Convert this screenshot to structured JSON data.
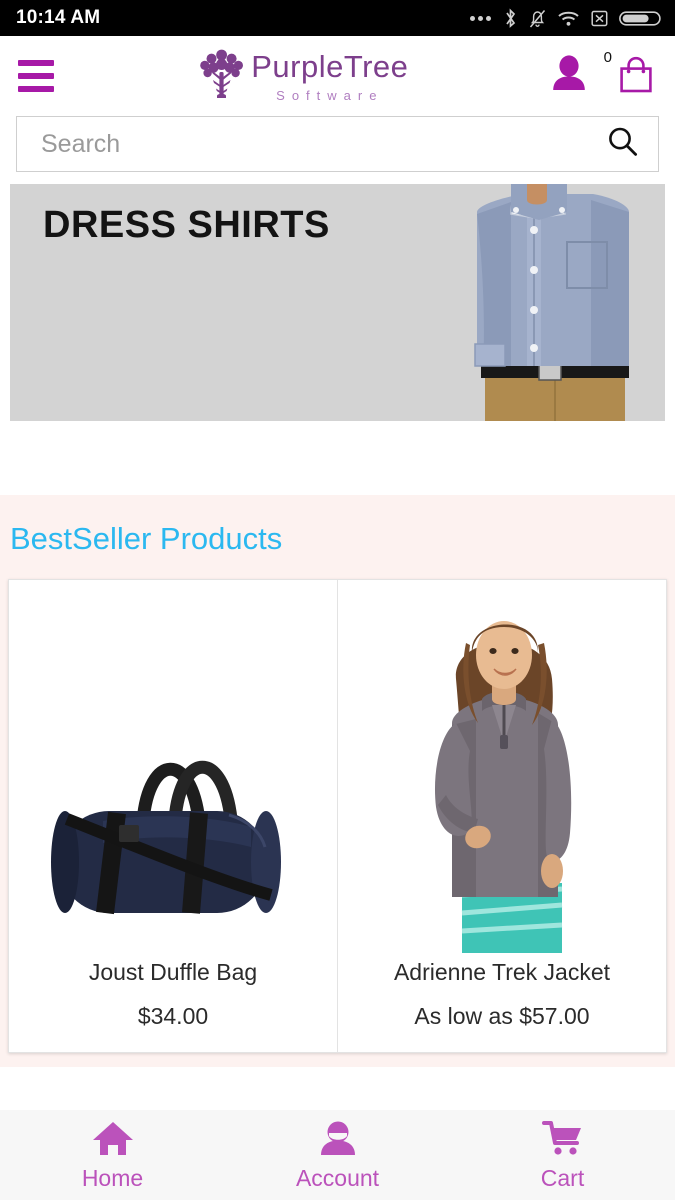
{
  "status_bar": {
    "time": "10:14 AM",
    "icons": [
      "more-dots-icon",
      "bluetooth-icon",
      "notifications-muted-icon",
      "wifi-icon",
      "no-sim-icon",
      "battery-icon"
    ]
  },
  "header": {
    "menu_icon": "hamburger-menu-icon",
    "logo": {
      "icon": "purple-tree-icon",
      "name": "PurpleTree",
      "tagline": "Software"
    },
    "account_icon": "user-icon",
    "cart_icon": "shopping-bag-icon",
    "cart_count": "0"
  },
  "search": {
    "placeholder": "Search",
    "value": "",
    "icon": "search-icon"
  },
  "banner": {
    "title": "DRESS SHIRTS",
    "image_alt": "man-in-dress-shirt"
  },
  "bestseller": {
    "title": "BestSeller Products",
    "products": [
      {
        "name": "Joust Duffle Bag",
        "price": "$34.00",
        "image_alt": "navy-duffle-bag"
      },
      {
        "name": "Adrienne Trek Jacket",
        "price": "As low as $57.00",
        "image_alt": "woman-in-gray-trek-jacket"
      }
    ]
  },
  "bottom_nav": {
    "items": [
      {
        "label": "Home",
        "icon": "home-icon"
      },
      {
        "label": "Account",
        "icon": "person-icon"
      },
      {
        "label": "Cart",
        "icon": "shopping-cart-icon"
      }
    ]
  },
  "colors": {
    "brand_purple": "#a719a7",
    "logo_purple": "#7d3f8c",
    "nav_purple": "#bb52bb",
    "heading_blue": "#2bb8f0",
    "section_bg": "#fdf2f0",
    "banner_bg": "#d3d3d3"
  }
}
